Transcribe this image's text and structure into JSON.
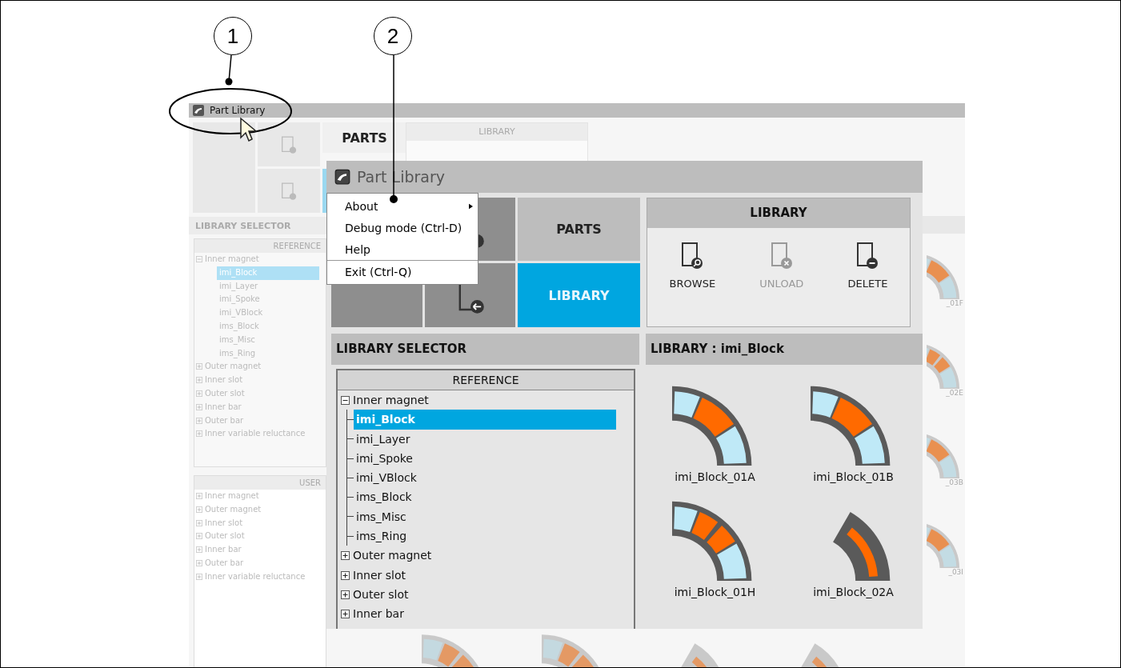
{
  "callouts": [
    {
      "label": "1"
    },
    {
      "label": "2"
    }
  ],
  "background_window": {
    "title": "Part Library",
    "tabs": [
      {
        "label": "PARTS",
        "selected": false
      }
    ],
    "library_panel": {
      "title": "LIBRARY"
    },
    "selector_title": "LIBRARY SELECTOR",
    "reference_tree": {
      "header": "REFERENCE",
      "items": [
        {
          "label": "Inner magnet",
          "expanded": true,
          "selected": false,
          "children": [
            {
              "label": "imi_Block",
              "selected": true
            },
            {
              "label": "imi_Layer",
              "selected": false
            },
            {
              "label": "imi_Spoke",
              "selected": false
            },
            {
              "label": "imi_VBlock",
              "selected": false
            },
            {
              "label": "ims_Block",
              "selected": false
            },
            {
              "label": "ims_Misc",
              "selected": false
            },
            {
              "label": "ims_Ring",
              "selected": false
            }
          ]
        },
        {
          "label": "Outer magnet",
          "expanded": false,
          "selected": false
        },
        {
          "label": "Inner slot",
          "expanded": false,
          "selected": false
        },
        {
          "label": "Outer slot",
          "expanded": false,
          "selected": false
        },
        {
          "label": "Inner bar",
          "expanded": false,
          "selected": false
        },
        {
          "label": "Outer bar",
          "expanded": false,
          "selected": false
        },
        {
          "label": "Inner variable reluctance",
          "expanded": false,
          "selected": false
        }
      ]
    },
    "user_tree": {
      "header": "USER",
      "items": [
        {
          "label": "Inner magnet",
          "expanded": false,
          "selected": false
        },
        {
          "label": "Outer magnet",
          "expanded": false,
          "selected": false
        },
        {
          "label": "Inner slot",
          "expanded": false,
          "selected": false
        },
        {
          "label": "Outer slot",
          "expanded": false,
          "selected": false
        },
        {
          "label": "Inner bar",
          "expanded": false,
          "selected": false
        },
        {
          "label": "Outer bar",
          "expanded": false,
          "selected": false
        },
        {
          "label": "Inner variable reluctance",
          "expanded": false,
          "selected": false
        }
      ]
    },
    "thumbnail_labels": [
      "_01F",
      "_02E",
      "_03B",
      "_03I"
    ]
  },
  "window": {
    "title": "Part Library",
    "menu": [
      {
        "label": "About",
        "submenu": true,
        "separator_before": false
      },
      {
        "label": "Debug mode (Ctrl-D)",
        "submenu": false,
        "separator_before": false
      },
      {
        "label": "Help",
        "submenu": false,
        "separator_before": false
      },
      {
        "label": "Exit (Ctrl-Q)",
        "submenu": false,
        "separator_before": true
      }
    ],
    "tabs": [
      {
        "label": "PARTS",
        "selected": false
      },
      {
        "label": "LIBRARY",
        "selected": true
      }
    ],
    "library_panel": {
      "title": "LIBRARY",
      "actions": [
        {
          "label": "BROWSE",
          "kind": "browse",
          "disabled": false
        },
        {
          "label": "UNLOAD",
          "kind": "unload",
          "disabled": true
        },
        {
          "label": "DELETE",
          "kind": "delete",
          "disabled": false
        }
      ]
    },
    "selector_title": "LIBRARY SELECTOR",
    "reference_tree": {
      "header": "REFERENCE",
      "items": [
        {
          "label": "Inner magnet",
          "expanded": true,
          "selected": false,
          "children": [
            {
              "label": "imi_Block",
              "selected": true
            },
            {
              "label": "imi_Layer",
              "selected": false
            },
            {
              "label": "imi_Spoke",
              "selected": false
            },
            {
              "label": "imi_VBlock",
              "selected": false
            },
            {
              "label": "ims_Block",
              "selected": false
            },
            {
              "label": "ims_Misc",
              "selected": false
            },
            {
              "label": "ims_Ring",
              "selected": false
            }
          ]
        },
        {
          "label": "Outer magnet",
          "expanded": false,
          "selected": false
        },
        {
          "label": "Inner slot",
          "expanded": false,
          "selected": false
        },
        {
          "label": "Outer slot",
          "expanded": false,
          "selected": false
        },
        {
          "label": "Inner bar",
          "expanded": false,
          "selected": false
        }
      ]
    },
    "library_title": "LIBRARY : imi_Block",
    "thumbnails": [
      {
        "label": "imi_Block_01A",
        "kind": "arc"
      },
      {
        "label": "imi_Block_01B",
        "kind": "arc"
      },
      {
        "label": "imi_Block_01H",
        "kind": "split-arc"
      },
      {
        "label": "imi_Block_02A",
        "kind": "wedge"
      }
    ]
  }
}
